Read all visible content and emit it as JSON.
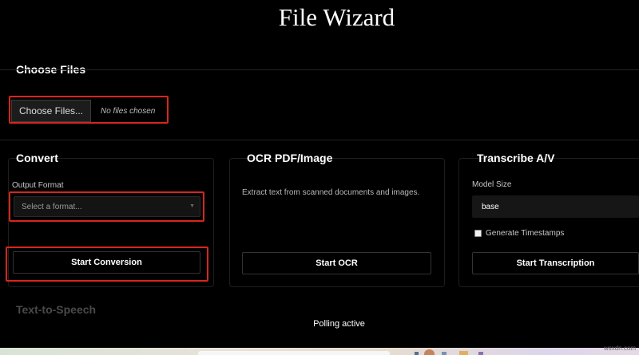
{
  "app": {
    "title": "File Wizard"
  },
  "choose_files": {
    "title": "Choose Files",
    "button_label": "Choose Files...",
    "status_text": "No files chosen"
  },
  "convert": {
    "title": "Convert",
    "output_format_label": "Output Format",
    "select_placeholder": "Select a format...",
    "start_label": "Start Conversion"
  },
  "ocr": {
    "title": "OCR PDF/Image",
    "description": "Extract text from scanned documents and images.",
    "start_label": "Start OCR"
  },
  "transcribe": {
    "title": "Transcribe A/V",
    "model_size_label": "Model Size",
    "model_size_value": "base",
    "timestamps_label": "Generate Timestamps",
    "timestamps_checked": false,
    "start_label": "Start Transcription"
  },
  "tts": {
    "title": "Text-to-Speech"
  },
  "status": {
    "text": "Polling active"
  },
  "watermark": {
    "text": "wsxdn.com"
  },
  "colors": {
    "background": "#000000",
    "highlight": "#d9251d",
    "card_border": "#1e1e1e"
  }
}
